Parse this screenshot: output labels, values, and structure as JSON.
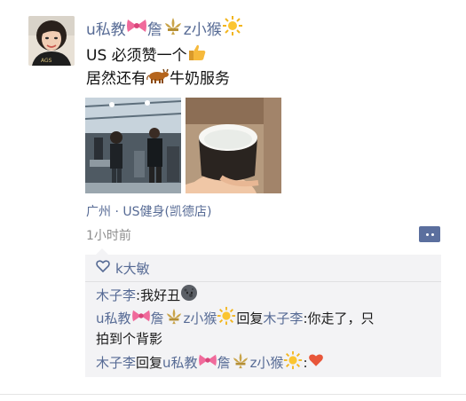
{
  "post": {
    "author_prefix": "u私教",
    "author_mid": "詹",
    "author_suffix": "z小猴",
    "text_line1_prefix": "US 必须赞一个",
    "text_line2_prefix": "居然还有",
    "text_line2_suffix": "牛奶服务",
    "location": "广州 · US健身(凯德店)",
    "time": "1小时前"
  },
  "likes": {
    "names": "k大敏"
  },
  "comments": [
    {
      "author": "木子李",
      "sep": ": ",
      "text": "我好丑"
    },
    {
      "author_prefix": "u私教",
      "author_mid": "詹",
      "author_suffix": "z小猴",
      "reply_word": "回复",
      "target": "木子李",
      "sep": ": ",
      "text_line1": "你走了，只",
      "text_line2": "拍到个背影"
    },
    {
      "author": "木子李",
      "reply_word": "回复",
      "target_prefix": "u私教",
      "target_mid": "詹",
      "target_suffix": "z小猴",
      "sep": ": "
    }
  ],
  "icons": {
    "bow": "pink-bow-icon",
    "fleur": "fleur-de-lis-icon",
    "sun": "sun-icon",
    "thumbs_up": "thumbs-up-icon",
    "cow": "cow-icon",
    "heart_outline": "heart-outline-icon",
    "moon": "new-moon-face-icon",
    "heart": "heart-icon",
    "more": "more-options-icon"
  },
  "colors": {
    "link": "#576b95",
    "comment_bg": "#f3f3f5",
    "time": "#8d8d8d"
  }
}
